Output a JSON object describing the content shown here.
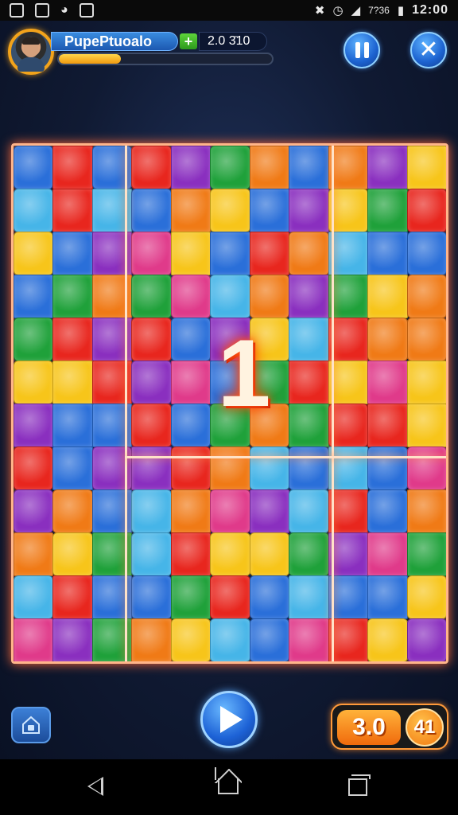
{
  "status_bar": {
    "time": "12:00",
    "battery": "7?36",
    "icons": [
      "image-icon",
      "gallery-icon",
      "android-icon",
      "notification-icon",
      "mute-icon",
      "wifi-icon",
      "signal-icon",
      "battery-icon"
    ]
  },
  "player": {
    "name": "PupePtuoalo",
    "plus_label": "+",
    "score": "2.0 3̄10",
    "progress_fraction": 0.29
  },
  "header_buttons": {
    "pause": "pause-icon",
    "close": "close-icon"
  },
  "board": {
    "center_number": "1",
    "rows": 12,
    "cols": 11,
    "palette": [
      "#e8261e",
      "#f7c51a",
      "#1fa13a",
      "#2a6fd9",
      "#8a2fbf",
      "#f07a16",
      "#e03a8a",
      "#46b5e8"
    ]
  },
  "controls": {
    "left_button": "home-lock-icon",
    "play_button": "play-icon",
    "counter_primary": "3.0",
    "counter_secondary": "41"
  },
  "navbar": {
    "icons": [
      "back-icon",
      "home-icon",
      "recents-icon"
    ]
  }
}
